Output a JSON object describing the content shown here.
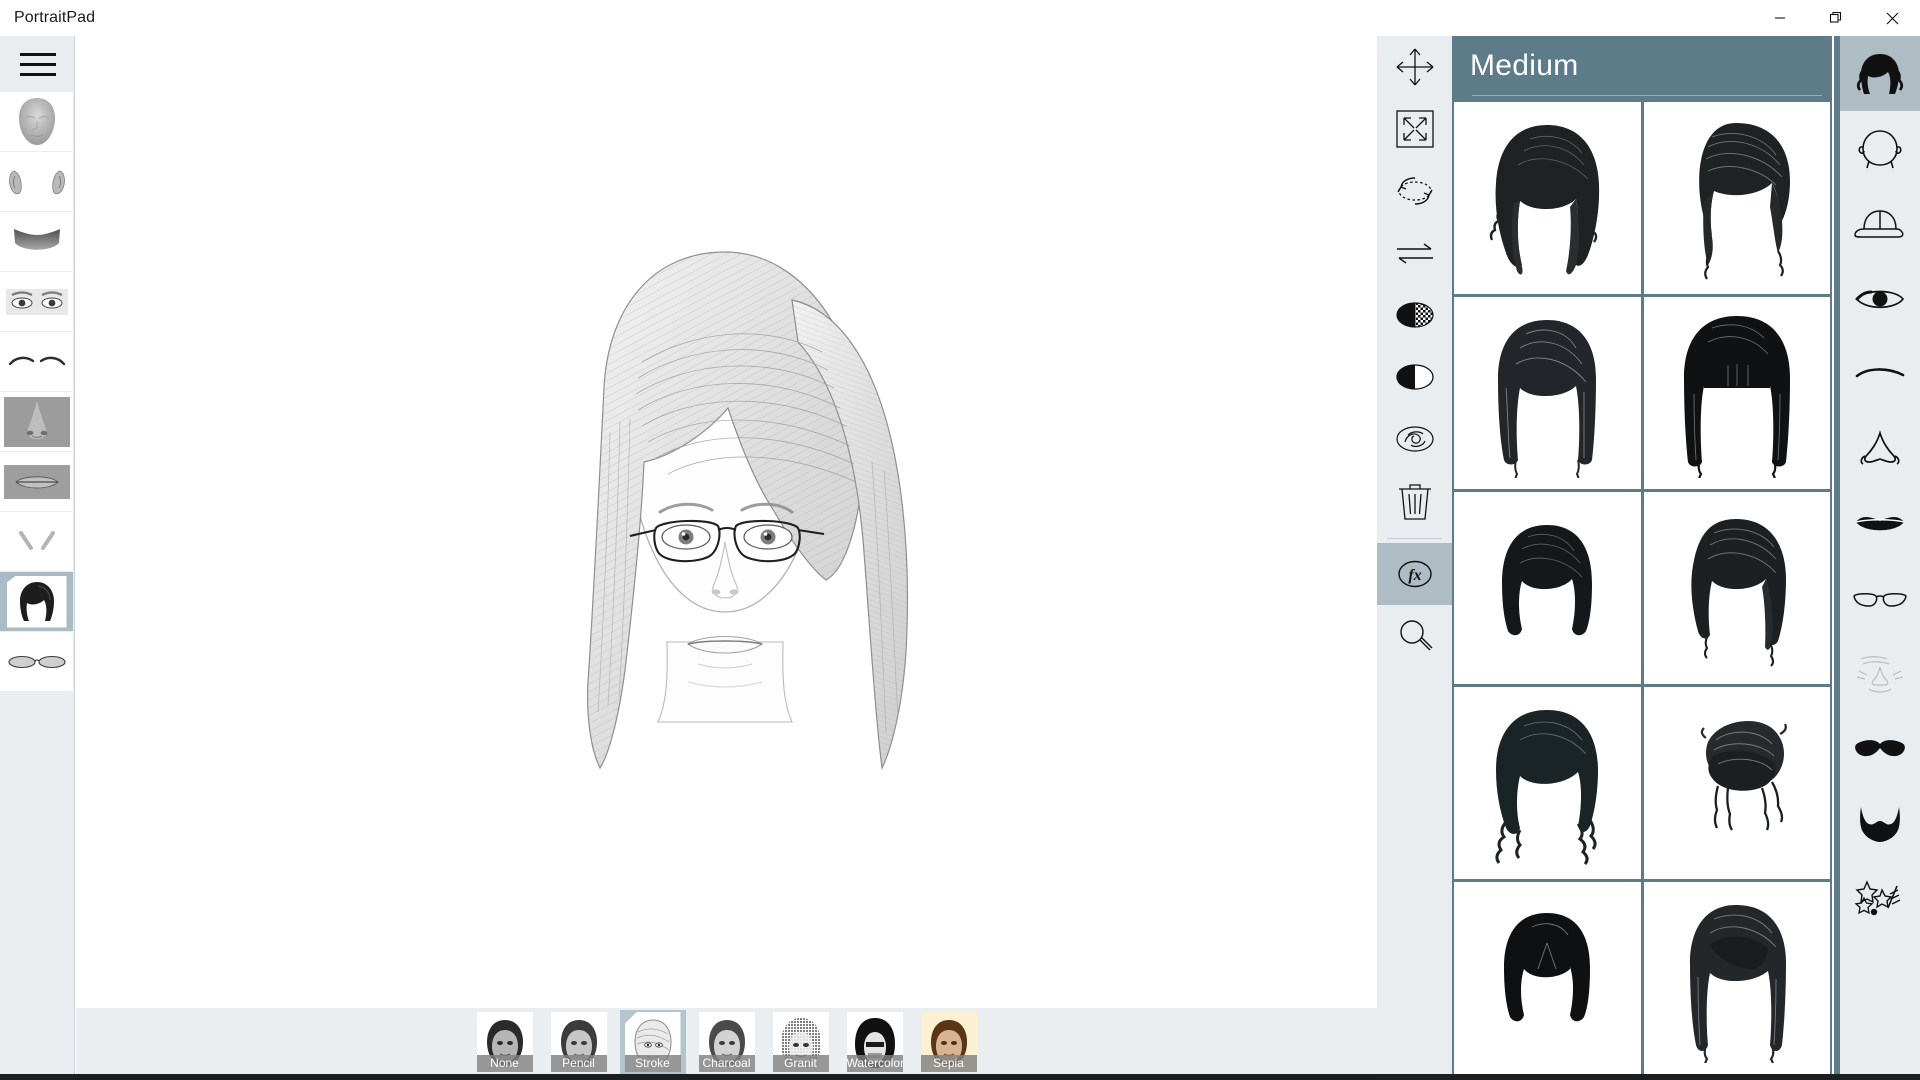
{
  "window": {
    "title": "PortraitPad",
    "controls": [
      {
        "name": "minimize",
        "glyph": "minimize-icon"
      },
      {
        "name": "maximize",
        "glyph": "maximize-icon"
      },
      {
        "name": "close",
        "glyph": "close-icon"
      }
    ]
  },
  "colors": {
    "panel_blue": "#5d7b89",
    "selection_blue": "#aebcc4",
    "rail_bg": "#e9edf0",
    "strip_bg": "#ebeef0",
    "canvas_bg": "#ffffff"
  },
  "menu": {
    "label": "Menu",
    "icon": "hamburger-icon"
  },
  "left_rail": {
    "items": [
      {
        "id": "face",
        "label": "Face shape",
        "icon": "face-shape-icon",
        "selected": false
      },
      {
        "id": "ears",
        "label": "Ears",
        "icon": "ears-icon",
        "selected": false
      },
      {
        "id": "hairline",
        "label": "Hairline",
        "icon": "hairline-icon",
        "selected": false
      },
      {
        "id": "eyes",
        "label": "Eyes",
        "icon": "eyes-icon",
        "selected": false
      },
      {
        "id": "eyebrows",
        "label": "Eyebrows",
        "icon": "eyebrows-icon",
        "selected": false
      },
      {
        "id": "nose",
        "label": "Nose",
        "icon": "nose-icon",
        "selected": false
      },
      {
        "id": "mouth",
        "label": "Mouth",
        "icon": "mouth-icon",
        "selected": false
      },
      {
        "id": "wrinkles",
        "label": "Wrinkles",
        "icon": "wrinkles-icon",
        "selected": false
      },
      {
        "id": "hair",
        "label": "Hair",
        "icon": "hair-icon",
        "selected": true
      },
      {
        "id": "glasses",
        "label": "Glasses",
        "icon": "glasses-icon",
        "selected": false
      }
    ]
  },
  "canvas": {
    "subject": "pencil-sketch portrait of a woman with medium bob hair and rimless glasses"
  },
  "filters": {
    "items": [
      {
        "id": "none",
        "label": "None",
        "selected": false
      },
      {
        "id": "pencil",
        "label": "Pencil",
        "selected": false
      },
      {
        "id": "stroke",
        "label": "Stroke",
        "selected": true
      },
      {
        "id": "charcoal",
        "label": "Charcoal",
        "selected": false
      },
      {
        "id": "granit",
        "label": "Granit",
        "selected": false
      },
      {
        "id": "watercolor",
        "label": "Watercolor",
        "selected": false
      },
      {
        "id": "sepia",
        "label": "Sepia",
        "selected": false
      }
    ]
  },
  "tools": {
    "items": [
      {
        "id": "move",
        "label": "Move",
        "icon": "move-arrows-icon",
        "active": false
      },
      {
        "id": "resize",
        "label": "Resize",
        "icon": "resize-icon",
        "active": false
      },
      {
        "id": "rotate",
        "label": "Rotate",
        "icon": "rotate-icon",
        "active": false
      },
      {
        "id": "flip",
        "label": "Flip",
        "icon": "flip-arrows-icon",
        "active": false
      },
      {
        "id": "transparency",
        "label": "Transparency",
        "icon": "transparency-icon",
        "active": false
      },
      {
        "id": "contrast",
        "label": "Contrast",
        "icon": "contrast-icon",
        "active": false
      },
      {
        "id": "blur",
        "label": "Blur",
        "icon": "blur-icon",
        "active": false
      },
      {
        "id": "delete",
        "label": "Delete",
        "icon": "trash-icon",
        "active": false
      },
      {
        "id": "fx",
        "label": "fx",
        "icon": "fx-icon",
        "active": true
      },
      {
        "id": "zoom",
        "label": "Zoom",
        "icon": "magnifier-icon",
        "active": false
      }
    ]
  },
  "style_panel": {
    "title": "Medium",
    "cells": [
      {
        "id": "h1",
        "label": "Wavy shoulder bob",
        "variant": "wavy-long"
      },
      {
        "id": "h2",
        "label": "Side swept pixie",
        "variant": "side-swept"
      },
      {
        "id": "h3",
        "label": "Straight bob",
        "variant": "straight-bob"
      },
      {
        "id": "h4",
        "label": "Blunt fringe bob",
        "variant": "fringe-bob"
      },
      {
        "id": "h5",
        "label": "Short rounded cut",
        "variant": "short-round"
      },
      {
        "id": "h6",
        "label": "Angled side bob",
        "variant": "angled-bob"
      },
      {
        "id": "h7",
        "label": "Curly shoulder length",
        "variant": "curly"
      },
      {
        "id": "h8",
        "label": "Messy updo",
        "variant": "updo"
      },
      {
        "id": "h9",
        "label": "Chin length with bangs",
        "variant": "chin-bangs"
      },
      {
        "id": "h10",
        "label": "Layered long fringe",
        "variant": "layered-fringe"
      }
    ]
  },
  "categories": {
    "items": [
      {
        "id": "hair",
        "label": "Hair",
        "icon": "hair-icon",
        "selected": true
      },
      {
        "id": "head",
        "label": "Head",
        "icon": "head-icon",
        "selected": false
      },
      {
        "id": "hat",
        "label": "Hat",
        "icon": "cap-icon",
        "selected": false
      },
      {
        "id": "eye",
        "label": "Eye",
        "icon": "eye-icon",
        "selected": false
      },
      {
        "id": "eyebrow",
        "label": "Eyebrow",
        "icon": "eyebrow-icon",
        "selected": false
      },
      {
        "id": "nose",
        "label": "Nose",
        "icon": "nose-icon",
        "selected": false
      },
      {
        "id": "mouth",
        "label": "Mouth",
        "icon": "lips-icon",
        "selected": false
      },
      {
        "id": "glasses",
        "label": "Glasses",
        "icon": "glasses-icon",
        "selected": false
      },
      {
        "id": "wrinkles",
        "label": "Wrinkles",
        "icon": "wrinkles-icon",
        "selected": false
      },
      {
        "id": "mustache",
        "label": "Mustache",
        "icon": "mustache-icon",
        "selected": false
      },
      {
        "id": "beard",
        "label": "Beard",
        "icon": "beard-icon",
        "selected": false
      },
      {
        "id": "marks",
        "label": "Marks",
        "icon": "stars-scar-icon",
        "selected": false
      }
    ]
  }
}
